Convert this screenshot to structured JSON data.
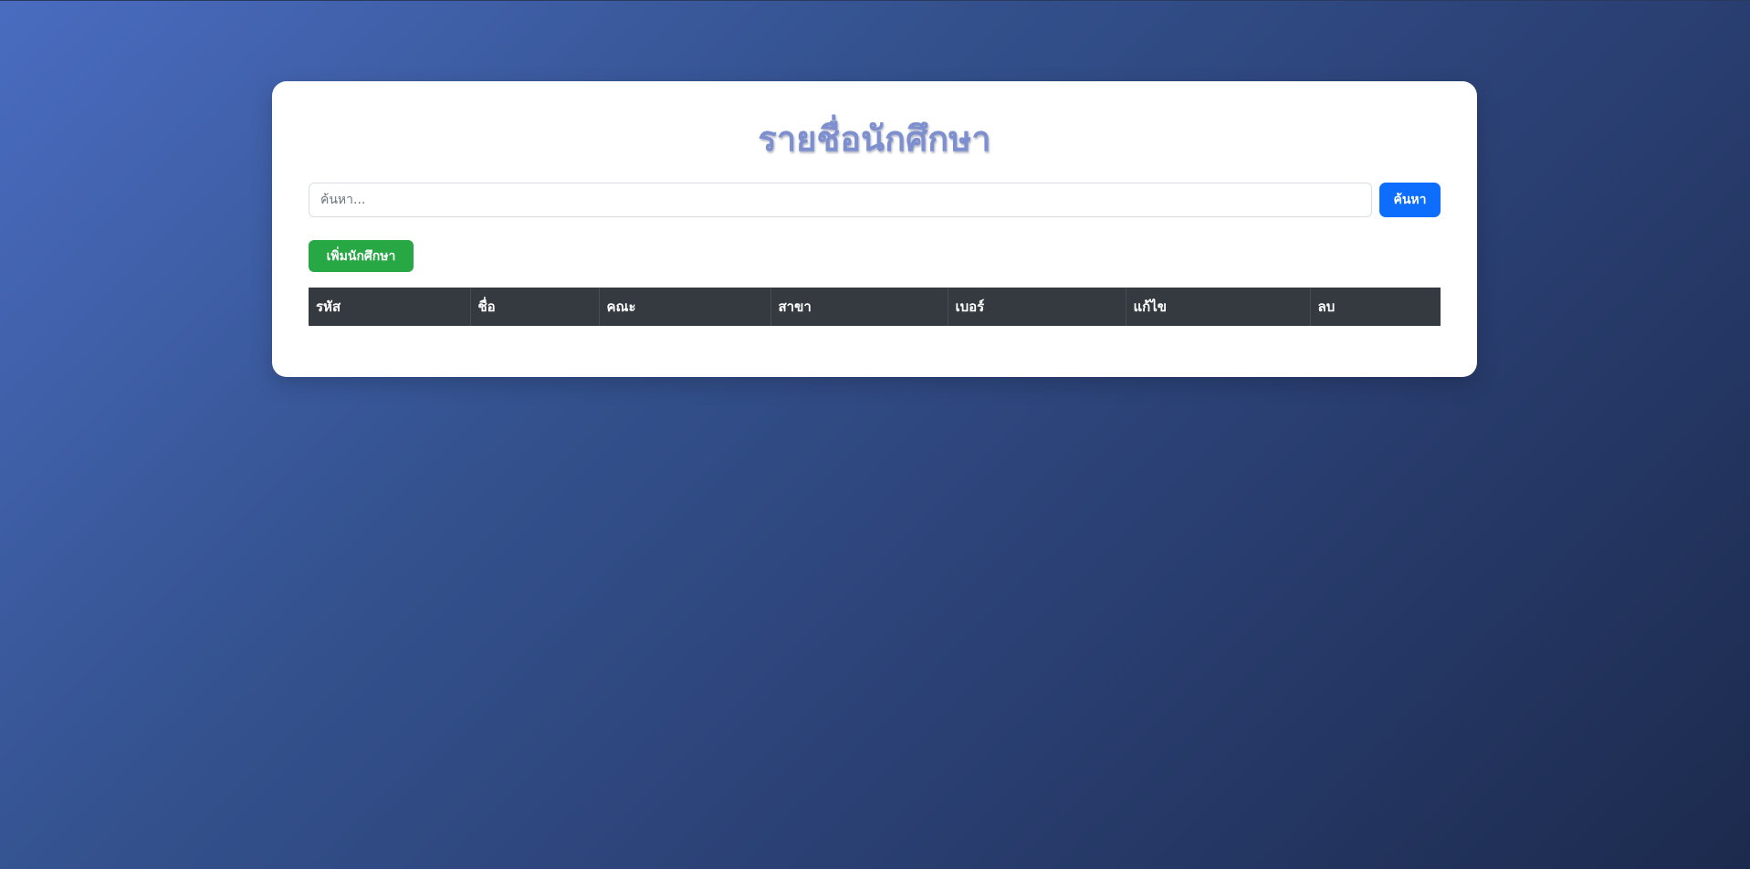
{
  "page": {
    "title": "รายชื่อนักศึกษา"
  },
  "search": {
    "placeholder": "ค้นหา...",
    "value": "",
    "button_label": "ค้นหา"
  },
  "actions": {
    "add_label": "เพิ่มนักศึกษา"
  },
  "table": {
    "columns": [
      "รหัส",
      "ชื่อ",
      "คณะ",
      "สาขา",
      "เบอร์",
      "แก้ไข",
      "ลบ"
    ],
    "rows": []
  },
  "colors": {
    "title": "#7d8fcf",
    "search_button": "#0d6efd",
    "add_button": "#28a745",
    "table_header": "#343a40"
  }
}
